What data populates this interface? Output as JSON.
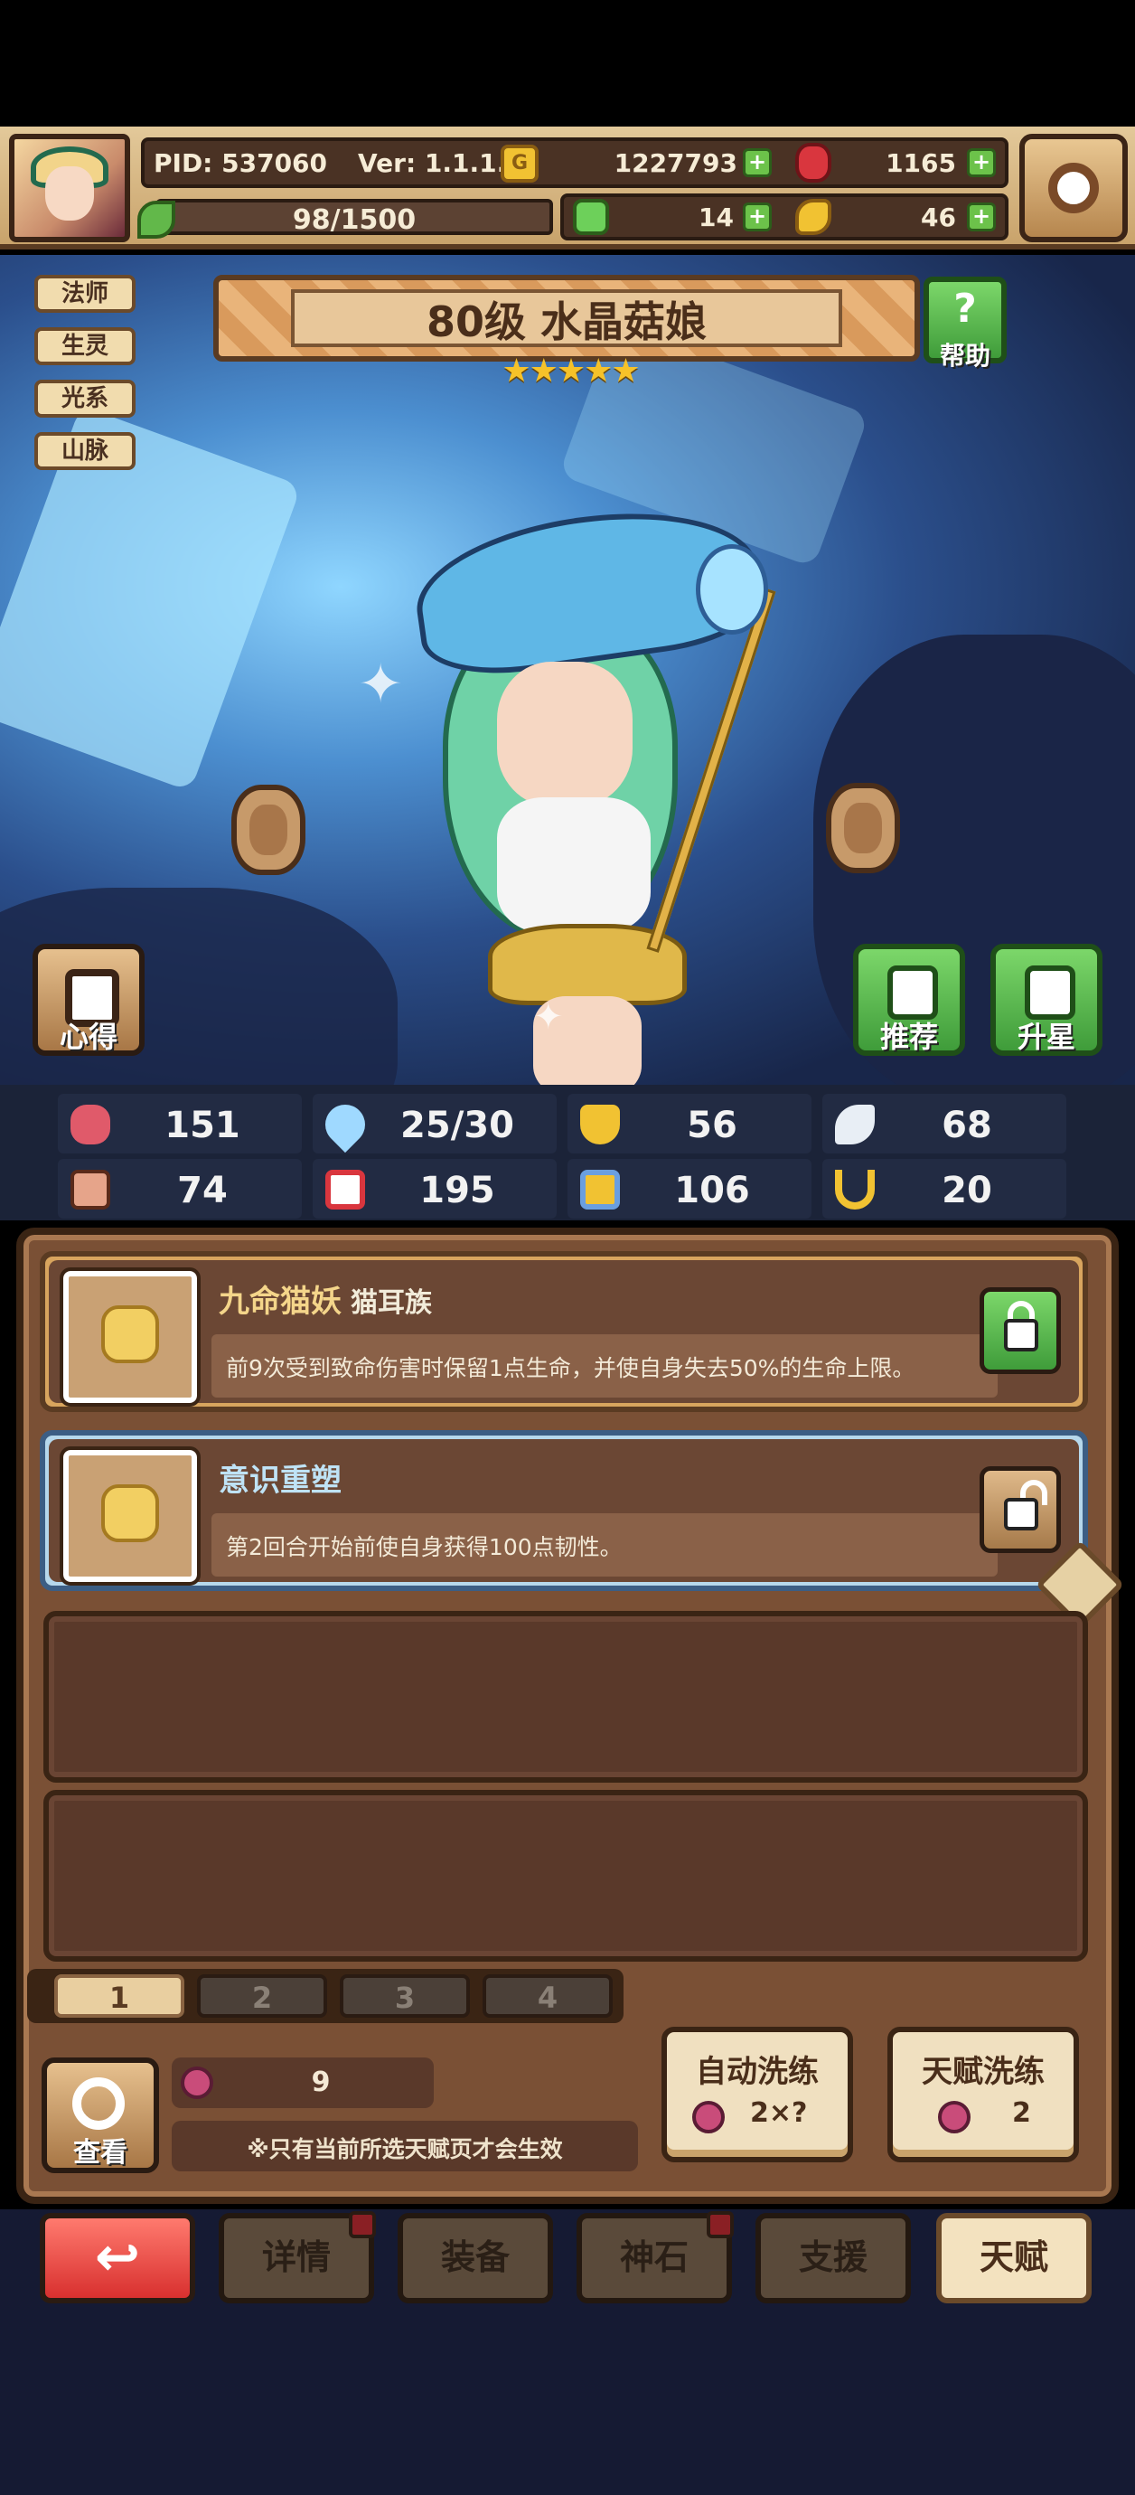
{
  "header": {
    "pid": "PID: 537060",
    "version": "Ver: 1.1.1.6",
    "gold": "1227793",
    "gems": "1165",
    "energy": "98/1500",
    "clover": "14",
    "keys": "46",
    "coin_glyph": "G"
  },
  "hero": {
    "tags": [
      "法师",
      "生灵",
      "光系",
      "山脉"
    ],
    "title": "80级 水晶菇娘",
    "stars": "★★★★★",
    "help_label": "帮助",
    "help_icon": "?",
    "buttons": {
      "xinde": "心得",
      "tuijian": "推荐",
      "shengxing": "升星"
    }
  },
  "stats": [
    {
      "icon": "heart-icon",
      "value": "151",
      "color": "#e05a6a"
    },
    {
      "icon": "mana-drop-icon",
      "value": "25/30",
      "color": "#9fd9ff"
    },
    {
      "icon": "shield-icon",
      "value": "56",
      "color": "#f1c232"
    },
    {
      "icon": "wing-icon",
      "value": "68",
      "color": "#e8eef5"
    },
    {
      "icon": "fist-icon",
      "value": "74",
      "color": "#e6a48a"
    },
    {
      "icon": "book-icon",
      "value": "195",
      "color": "#d9363e"
    },
    {
      "icon": "scroll-icon",
      "value": "106",
      "color": "#6a9fe0"
    },
    {
      "icon": "horseshoe-icon",
      "value": "20",
      "color": "#f1c232"
    }
  ],
  "talents": [
    {
      "name": "九命猫妖",
      "sub": "猫耳族",
      "desc": "前9次受到致命伤害时保留1点生命，并使自身失去50%的生命上限。",
      "lock": "locked",
      "frame": "gold"
    },
    {
      "name": "意识重塑",
      "sub": "",
      "desc": "第2回合开始前使自身获得100点韧性。",
      "lock": "unlocked",
      "frame": "blue"
    }
  ],
  "pages": {
    "tabs": [
      "1",
      "2",
      "3",
      "4"
    ],
    "active": "1"
  },
  "controls": {
    "view_label": "查看",
    "berry_count": "9",
    "note": "※只有当前所选天赋页才会生效",
    "auto_wash": {
      "label": "自动洗练",
      "cost": "2×?"
    },
    "talent_wash": {
      "label": "天赋洗练",
      "cost": "2"
    }
  },
  "nav": {
    "back_glyph": "↩",
    "items": [
      {
        "label": "详情",
        "dot": true
      },
      {
        "label": "装备",
        "dot": false
      },
      {
        "label": "神石",
        "dot": true
      },
      {
        "label": "支援",
        "dot": false
      },
      {
        "label": "天赋",
        "dot": false,
        "active": true
      }
    ]
  }
}
